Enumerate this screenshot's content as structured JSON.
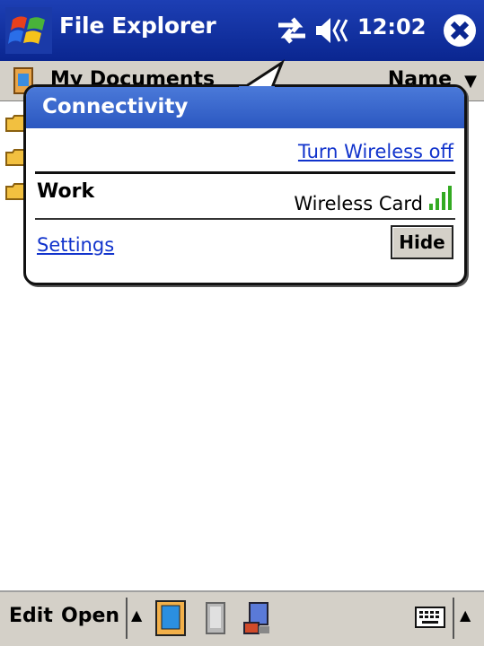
{
  "titlebar": {
    "app_title": "File Explorer",
    "clock": "12:02",
    "icons": [
      "windows-start-icon",
      "connectivity-icon",
      "speaker-icon",
      "close-icon"
    ]
  },
  "folderbar": {
    "folder_name": "My Documents",
    "sort_label": "Name"
  },
  "popup": {
    "title": "Connectivity",
    "wireless_link": "Turn Wireless off",
    "network_name": "Work",
    "adapter": "Wireless Card",
    "settings_link": "Settings",
    "hide_button": "Hide"
  },
  "menubar": {
    "edit_label": "Edit",
    "open_label": "Open"
  },
  "colors": {
    "titlebar": "#0a2690",
    "popup_header": "#2b57c0",
    "link": "#1133cc",
    "signal": "#33aa22"
  }
}
